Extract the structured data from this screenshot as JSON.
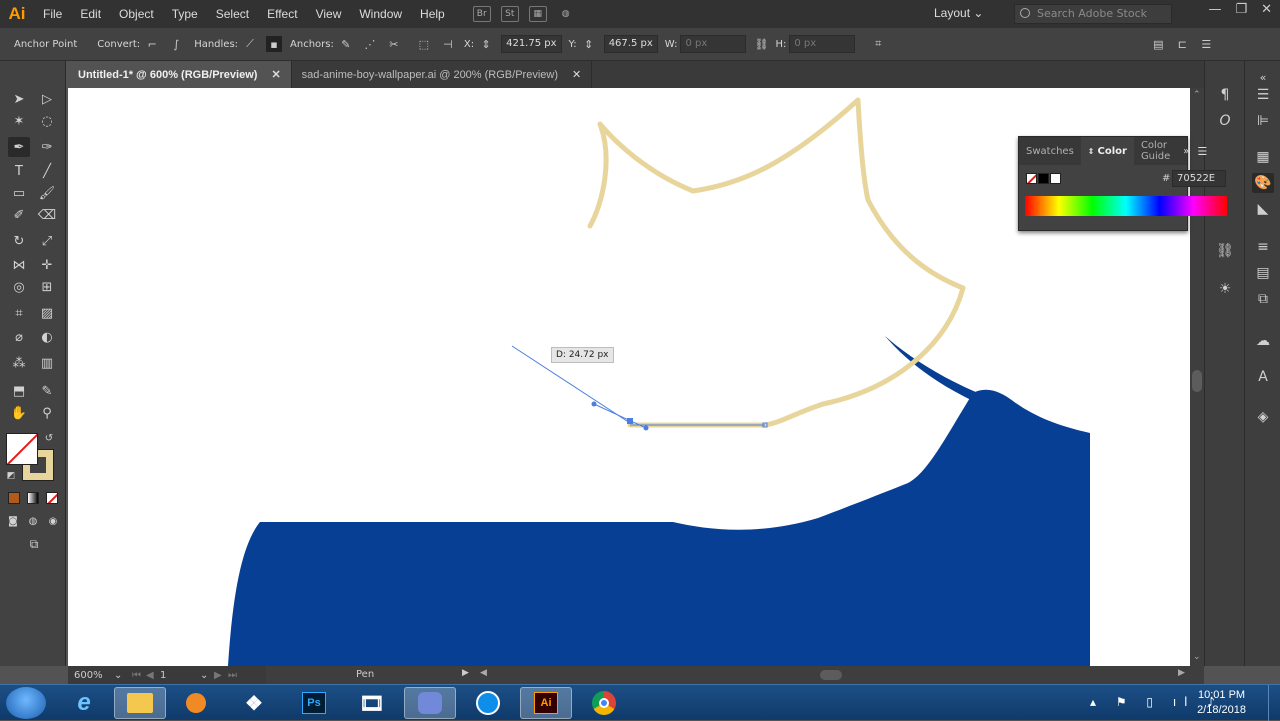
{
  "app": {
    "logo": "Ai"
  },
  "menu": [
    "File",
    "Edit",
    "Object",
    "Type",
    "Select",
    "Effect",
    "View",
    "Window",
    "Help"
  ],
  "menu_icons": {
    "bridge": "Br",
    "stock": "St"
  },
  "workspace": "Layout",
  "search": {
    "placeholder": "Search Adobe Stock"
  },
  "control": {
    "tool_label": "Anchor Point",
    "convert": "Convert:",
    "handles": "Handles:",
    "anchors": "Anchors:",
    "x_label": "X:",
    "x_value": "421.75 px",
    "y_label": "Y:",
    "y_value": "467.5 px",
    "w_label": "W:",
    "w_value": "0 px",
    "h_label": "H:",
    "h_value": "0 px"
  },
  "tabs": [
    {
      "label": "Untitled-1* @ 600% (RGB/Preview)",
      "active": true
    },
    {
      "label": "sad-anime-boy-wallpaper.ai @ 200% (RGB/Preview)",
      "active": false
    }
  ],
  "canvas": {
    "tooltip": "D: 24.72 px"
  },
  "color_panel": {
    "tabs": [
      "Swatches",
      "Color",
      "Color Guide"
    ],
    "hash": "#",
    "hex": "70522E"
  },
  "status": {
    "zoom": "600%",
    "artboard": "1",
    "tool": "Pen"
  },
  "taskbar": {
    "apps": [
      "e",
      "Ps",
      "Ai"
    ],
    "time": "10:01 PM",
    "date": "2/18/2018"
  },
  "colors": {
    "stroke": "#e8d59c",
    "fill": "#073f95",
    "path": "#4a7fe0",
    "accent": "#ff9a00"
  }
}
